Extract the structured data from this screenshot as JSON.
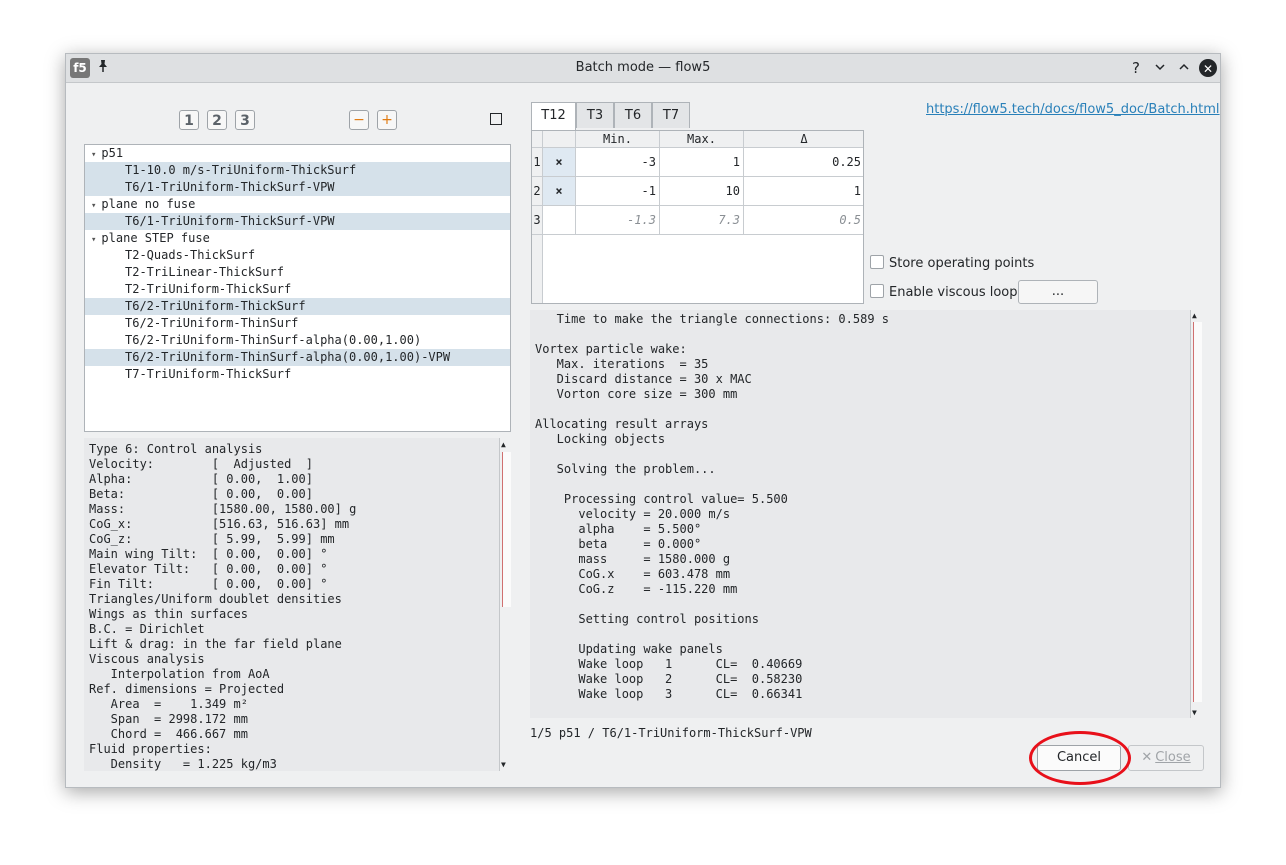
{
  "window": {
    "title": "Batch mode — flow5",
    "app_icon_text": "f5",
    "pin_glyph": "📌",
    "help_glyph": "?",
    "minimize_glyph": "⌄",
    "maximize_glyph": "⌃",
    "close_glyph": "✕"
  },
  "toolbar": {
    "num_buttons": [
      "1",
      "2",
      "3"
    ],
    "minus_label": "−",
    "plus_label": "+"
  },
  "tree": {
    "rows": [
      {
        "text": "p51",
        "level": 0,
        "sel": false
      },
      {
        "text": "T1-10.0 m/s-TriUniform-ThickSurf",
        "level": 1,
        "sel": true
      },
      {
        "text": "T6/1-TriUniform-ThickSurf-VPW",
        "level": 1,
        "sel": true
      },
      {
        "text": "plane no fuse",
        "level": 0,
        "sel": false
      },
      {
        "text": "T6/1-TriUniform-ThickSurf-VPW",
        "level": 1,
        "sel": true
      },
      {
        "text": "plane STEP fuse",
        "level": 0,
        "sel": false
      },
      {
        "text": "T2-Quads-ThickSurf",
        "level": 1,
        "sel": false
      },
      {
        "text": "T2-TriLinear-ThickSurf",
        "level": 1,
        "sel": false
      },
      {
        "text": "T2-TriUniform-ThickSurf",
        "level": 1,
        "sel": false
      },
      {
        "text": "T6/2-TriUniform-ThickSurf",
        "level": 1,
        "sel": true
      },
      {
        "text": "T6/2-TriUniform-ThinSurf",
        "level": 1,
        "sel": false
      },
      {
        "text": "T6/2-TriUniform-ThinSurf-alpha(0.00,1.00)",
        "level": 1,
        "sel": false
      },
      {
        "text": "T6/2-TriUniform-ThinSurf-alpha(0.00,1.00)-VPW",
        "level": 1,
        "sel": true
      },
      {
        "text": "T7-TriUniform-ThickSurf",
        "level": 1,
        "sel": false
      }
    ]
  },
  "props": {
    "lines": [
      "Type 6: Control analysis",
      "Velocity:        [  Adjusted  ]",
      "Alpha:           [ 0.00,  1.00]",
      "Beta:            [ 0.00,  0.00]",
      "Mass:            [1580.00, 1580.00] g",
      "CoG_x:           [516.63, 516.63] mm",
      "CoG_z:           [ 5.99,  5.99] mm",
      "Main wing Tilt:  [ 0.00,  0.00] °",
      "Elevator Tilt:   [ 0.00,  0.00] °",
      "Fin Tilt:        [ 0.00,  0.00] °",
      "Triangles/Uniform doublet densities",
      "Wings as thin surfaces",
      "B.C. = Dirichlet",
      "Lift & drag: in the far field plane",
      "Viscous analysis",
      "   Interpolation from AoA",
      "Ref. dimensions = Projected",
      "   Area  =    1.349 m²",
      "   Span  = 2998.172 mm",
      "   Chord =  466.667 mm",
      "Fluid properties:",
      "   Density   = 1.225 kg/m3"
    ]
  },
  "tabs": [
    "T12",
    "T3",
    "T6",
    "T7"
  ],
  "grid": {
    "headers": [
      "Min.",
      "Max.",
      "Δ"
    ],
    "rows": [
      {
        "n": "1",
        "check": "×",
        "min": "-3",
        "max": "1",
        "delta": "0.25",
        "italic": false
      },
      {
        "n": "2",
        "check": "×",
        "min": "-1",
        "max": "10",
        "delta": "1",
        "italic": false
      },
      {
        "n": "3",
        "check": "",
        "min": "-1.3",
        "max": "7.3",
        "delta": "0.5",
        "italic": true
      }
    ]
  },
  "link": {
    "url": "https://flow5.tech/docs/flow5_doc/Batch.html"
  },
  "options": {
    "store_label": "Store operating points",
    "viscous_label": "Enable viscous loop",
    "dots_label": "..."
  },
  "log": {
    "lines": [
      "   Time to make the triangle connections: 0.589 s",
      "",
      "Vortex particle wake:",
      "   Max. iterations  = 35",
      "   Discard distance = 30 x MAC",
      "   Vorton core size = 300 mm",
      "",
      "Allocating result arrays",
      "   Locking objects",
      "",
      "   Solving the problem...",
      "",
      "    Processing control value= 5.500",
      "      velocity = 20.000 m/s",
      "      alpha    = 5.500°",
      "      beta     = 0.000°",
      "      mass     = 1580.000 g",
      "      CoG.x    = 603.478 mm",
      "      CoG.z    = -115.220 mm",
      "",
      "      Setting control positions",
      "",
      "      Updating wake panels",
      "      Wake loop   1      CL=  0.40669",
      "      Wake loop   2      CL=  0.58230",
      "      Wake loop   3      CL=  0.66341"
    ]
  },
  "status": {
    "text": "1/5 p51 / T6/1-TriUniform-ThickSurf-VPW"
  },
  "buttons": {
    "cancel": "Cancel",
    "close": "Close",
    "close_icon": "✕"
  },
  "colors": {
    "selection": "#d5e1ea",
    "highlight": "#e8101a",
    "link": "#2980b9"
  }
}
